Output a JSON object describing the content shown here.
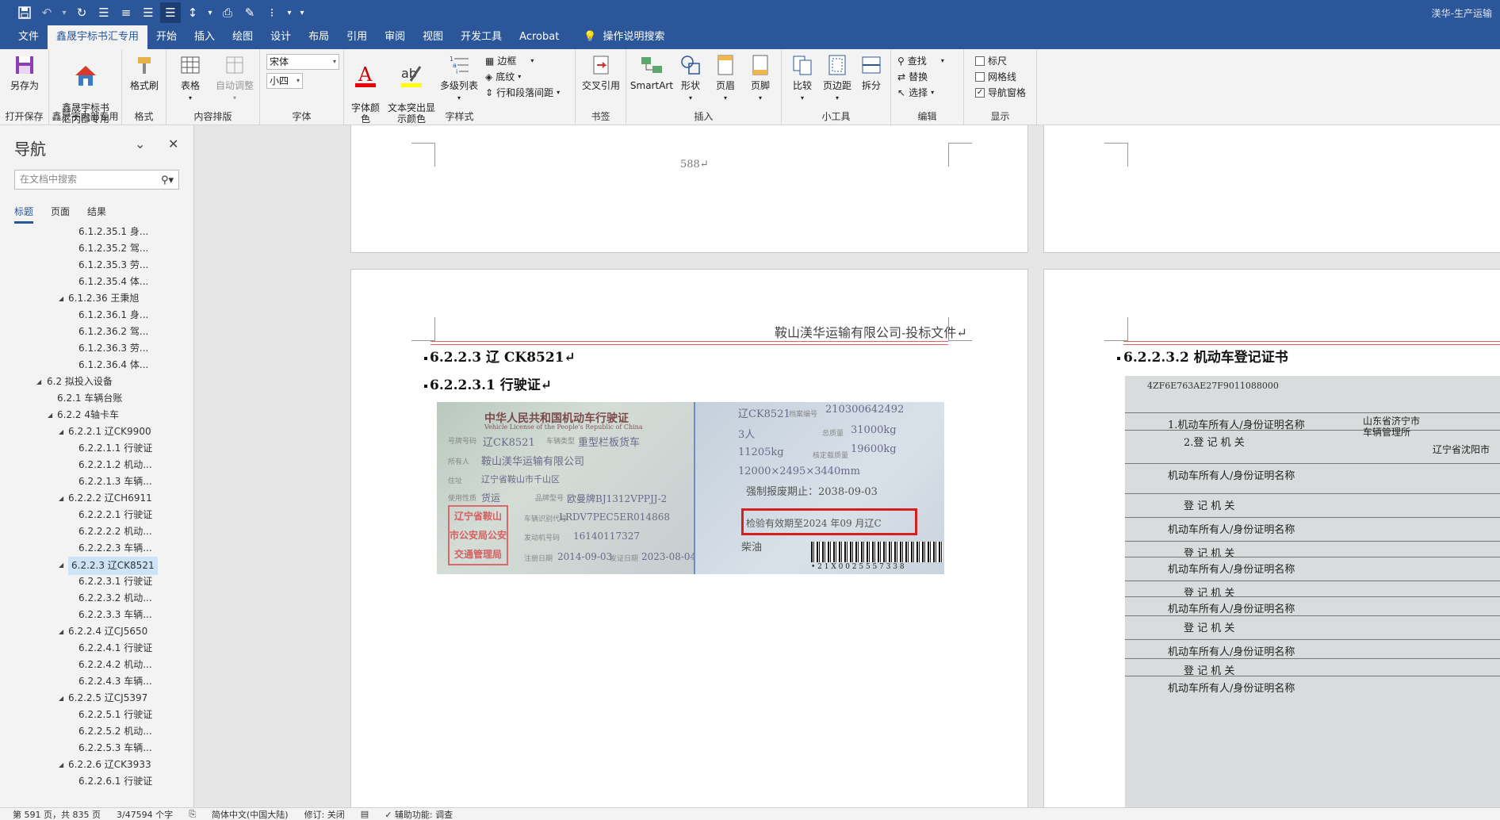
{
  "window": {
    "title": "渼华-生产运输"
  },
  "qat": {
    "more": "▾"
  },
  "tabs": [
    "文件",
    "鑫晟宇标书汇专用",
    "开始",
    "插入",
    "绘图",
    "设计",
    "布局",
    "引用",
    "审阅",
    "视图",
    "开发工具",
    "Acrobat"
  ],
  "tab_search": "操作说明搜索",
  "ribbon": {
    "save_as": "另存为",
    "g_open_save": "打开保存",
    "xsy_btn": "鑫晟宇标书\n汇内部专用",
    "g_xsy": "鑫晟宇内部专用",
    "format_painter": "格式刷",
    "g_format": "格式",
    "table": "表格",
    "auto_adjust": "自动调整",
    "g_content": "内容排版",
    "font_name": "宋体",
    "font_size": "小四",
    "g_font": "字体",
    "font_color": "字体颜\n色",
    "highlight": "文本突出显\n示颜色",
    "multilevel": "多级列表",
    "border": "边框",
    "shading": "底纹",
    "line_para": "行和段落间距",
    "g_style": "字样式",
    "crossref": "交叉引用",
    "g_bookmark": "书签",
    "smartart": "SmartArt",
    "shape": "形状",
    "header": "页眉",
    "footer": "页脚",
    "g_insert": "插入",
    "compare": "比较",
    "margins": "页边距",
    "split": "拆分",
    "g_tools": "小工具",
    "find": "查找",
    "replace": "替换",
    "select": "选择",
    "g_edit": "编辑",
    "ruler": "标尺",
    "grid": "网格线",
    "nav_pane": "导航窗格",
    "g_show": "显示"
  },
  "nav": {
    "title": "导航",
    "search_placeholder": "在文档中搜索",
    "tabs": [
      "标题",
      "页面",
      "结果"
    ],
    "items": [
      {
        "label": "6.1.2.35.1 身...",
        "level": 4,
        "tri": ""
      },
      {
        "label": "6.1.2.35.2 驾...",
        "level": 4,
        "tri": ""
      },
      {
        "label": "6.1.2.35.3 劳...",
        "level": 4,
        "tri": ""
      },
      {
        "label": "6.1.2.35.4 体...",
        "level": 4,
        "tri": ""
      },
      {
        "label": "6.1.2.36 王秉旭",
        "level": 3,
        "tri": "◢"
      },
      {
        "label": "6.1.2.36.1 身...",
        "level": 4,
        "tri": ""
      },
      {
        "label": "6.1.2.36.2 驾...",
        "level": 4,
        "tri": ""
      },
      {
        "label": "6.1.2.36.3 劳...",
        "level": 4,
        "tri": ""
      },
      {
        "label": "6.1.2.36.4 体...",
        "level": 4,
        "tri": ""
      },
      {
        "label": "6.2 拟投入设备",
        "level": 1,
        "tri": "◢"
      },
      {
        "label": "6.2.1 车辆台账",
        "level": 2,
        "tri": ""
      },
      {
        "label": "6.2.2 4轴卡车",
        "level": 2,
        "tri": "◢"
      },
      {
        "label": "6.2.2.1 辽CK9900",
        "level": 3,
        "tri": "◢"
      },
      {
        "label": "6.2.2.1.1 行驶证",
        "level": 4,
        "tri": ""
      },
      {
        "label": "6.2.2.1.2 机动...",
        "level": 4,
        "tri": ""
      },
      {
        "label": "6.2.2.1.3 车辆...",
        "level": 4,
        "tri": ""
      },
      {
        "label": "6.2.2.2 辽CH6911",
        "level": 3,
        "tri": "◢"
      },
      {
        "label": "6.2.2.2.1 行驶证",
        "level": 4,
        "tri": ""
      },
      {
        "label": "6.2.2.2.2 机动...",
        "level": 4,
        "tri": ""
      },
      {
        "label": "6.2.2.2.3 车辆...",
        "level": 4,
        "tri": ""
      },
      {
        "label": "6.2.2.3 辽CK8521",
        "level": 3,
        "tri": "◢",
        "selected": true
      },
      {
        "label": "6.2.2.3.1 行驶证",
        "level": 4,
        "tri": ""
      },
      {
        "label": "6.2.2.3.2 机动...",
        "level": 4,
        "tri": ""
      },
      {
        "label": "6.2.2.3.3 车辆...",
        "level": 4,
        "tri": ""
      },
      {
        "label": "6.2.2.4 辽CJ5650",
        "level": 3,
        "tri": "◢"
      },
      {
        "label": "6.2.2.4.1 行驶证",
        "level": 4,
        "tri": ""
      },
      {
        "label": "6.2.2.4.2 机动...",
        "level": 4,
        "tri": ""
      },
      {
        "label": "6.2.2.4.3 车辆...",
        "level": 4,
        "tri": ""
      },
      {
        "label": "6.2.2.5 辽CJ5397",
        "level": 3,
        "tri": "◢"
      },
      {
        "label": "6.2.2.5.1 行驶证",
        "level": 4,
        "tri": ""
      },
      {
        "label": "6.2.2.5.2 机动...",
        "level": 4,
        "tri": ""
      },
      {
        "label": "6.2.2.5.3 车辆...",
        "level": 4,
        "tri": ""
      },
      {
        "label": "6.2.2.6 辽CK3933",
        "level": 3,
        "tri": "◢"
      },
      {
        "label": "6.2.2.6.1 行驶证",
        "level": 4,
        "tri": ""
      }
    ]
  },
  "doc": {
    "page_number": "588↵",
    "header_text": "鞍山渼华运输有限公司-投标文件↵",
    "h1": "6.2.2.3    辽 CK8521↵",
    "h2": "6.2.2.3.1  行驶证↵",
    "h_right": "6.2.2.3.2  机动车登记证书",
    "license": {
      "title": "中华人民共和国机动车行驶证",
      "title_en": "Vehicle License of the People's Republic of China",
      "plate_label": "号牌号码",
      "plate": "辽CK8521",
      "type_label": "车辆类型",
      "type": "重型栏板货车",
      "owner_label": "所有人",
      "owner": "鞍山渼华运输有限公司",
      "address_label": "住址",
      "address": "辽宁省鞍山市千山区",
      "usage_label": "使用性质",
      "usage": "货运",
      "model_label": "品牌型号",
      "model": "欧曼牌BJ1312VPPJJ-2",
      "vin_label": "车辆识别代号",
      "vin": "LRDV7PEC5ER014868",
      "engine_label": "发动机号码",
      "engine": "16140117327",
      "reg_label": "注册日期",
      "reg_date": "2014-09-03",
      "issue_label": "发证日期",
      "issue_date": "2023-08-04",
      "stamp": "辽宁省鞍山\n市公安局公安\n交通管理局",
      "b_plate": "辽CK8521",
      "b_file_no": "210300642492",
      "b_file_label": "档案编号",
      "b_seats": "3人",
      "b_total_mass_label": "总质量",
      "b_total_mass": "31000kg",
      "b_curb": "11205kg",
      "b_rated_label": "核定载质量",
      "b_rated": "19600kg",
      "b_dims": "12000×2495×3440mm",
      "b_scrap": "强制报废期止：2038-09-03",
      "b_inspect": "检验有效期至2024 年09 月辽C",
      "b_fuel": "柴油",
      "b_barcode": "• 2 1 X 0 0 2 5 5 5 7 3 3 8"
    },
    "reg_cert": {
      "code": "4ZF6E763AE27F9011088000",
      "rows": [
        "1.机动车所有人/身份证明名称",
        "2.登 记 机 关",
        "机动车所有人/身份证明名称",
        "登 记 机 关",
        "机动车所有人/身份证明名称",
        "登 记 机 关",
        "机动车所有人/身份证明名称",
        "登 记 机 关",
        "机动车所有人/身份证明名称",
        "登 记 机 关",
        "机动车所有人/身份证明名称",
        "登 记 机 关",
        "机动车所有人/身份证明名称"
      ],
      "right1": "山东省济宁市",
      "right2": "车辆管理所",
      "right3": "辽宁省沈阳市"
    }
  },
  "status": {
    "page": "第 591 页，共 835 页",
    "words": "3/47594 个字",
    "lang": "简体中文(中国大陆)",
    "track": "修订: 关闭",
    "access": "辅助功能: 调查"
  }
}
